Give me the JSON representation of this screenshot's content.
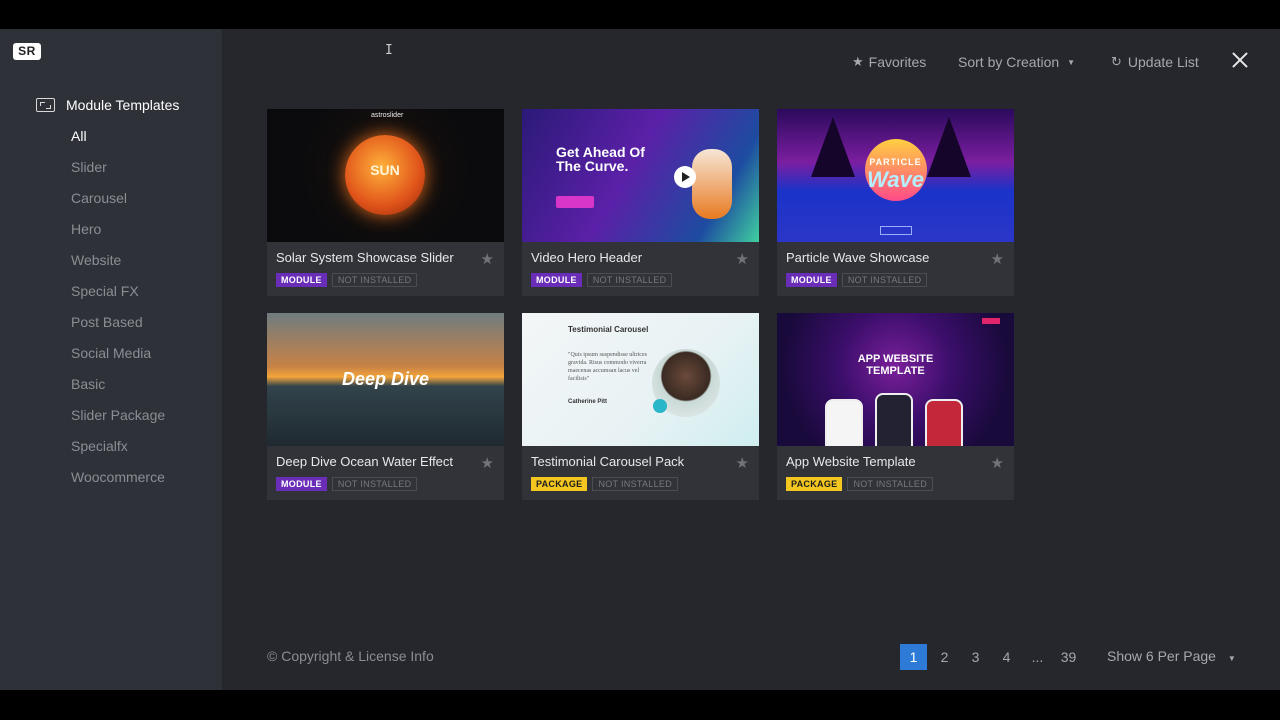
{
  "app": {
    "logo": "SR"
  },
  "sidebar": {
    "header": "Module Templates",
    "items": [
      {
        "label": "All",
        "active": true
      },
      {
        "label": "Slider"
      },
      {
        "label": "Carousel"
      },
      {
        "label": "Hero"
      },
      {
        "label": "Website"
      },
      {
        "label": "Special FX"
      },
      {
        "label": "Post Based"
      },
      {
        "label": "Social Media"
      },
      {
        "label": "Basic"
      },
      {
        "label": "Slider Package"
      },
      {
        "label": "Specialfx"
      },
      {
        "label": "Woocommerce"
      }
    ]
  },
  "toolbar": {
    "favorites": "Favorites",
    "sort": "Sort by Creation",
    "update": "Update List"
  },
  "cards": [
    {
      "title": "Solar System Showcase Slider",
      "type": "MODULE",
      "status": "NOT INSTALLED",
      "thumb_text": "SUN",
      "thumb_brand": "astroslider"
    },
    {
      "title": "Video Hero Header",
      "type": "MODULE",
      "status": "NOT INSTALLED",
      "thumb_text": "Get Ahead Of The Curve."
    },
    {
      "title": "Particle Wave Showcase",
      "type": "MODULE",
      "status": "NOT INSTALLED",
      "thumb_text": "PARTICLE",
      "thumb_text2": "Wave"
    },
    {
      "title": "Deep Dive Ocean Water Effect",
      "type": "MODULE",
      "status": "NOT INSTALLED",
      "thumb_text": "Deep Dive"
    },
    {
      "title": "Testimonial Carousel Pack",
      "type": "PACKAGE",
      "status": "NOT INSTALLED",
      "thumb_text": "Testimonial Carousel",
      "thumb_quote": "\"Quis ipsum suspendisse ultrices gravida. Risus commodo viverra maecenas accumsan lacus vel facilisis\"",
      "thumb_name": "Catherine Pitt"
    },
    {
      "title": "App Website Template",
      "type": "PACKAGE",
      "status": "NOT INSTALLED",
      "thumb_text": "APP WEBSITE TEMPLATE"
    }
  ],
  "footer": {
    "copyright": "© Copyright & License Info",
    "pages": [
      "1",
      "2",
      "3",
      "4",
      "...",
      "39"
    ],
    "current_page": "1",
    "per_page": "Show 6 Per Page"
  },
  "colors": {
    "module": "#6a2db8",
    "package": "#f4c620",
    "accent": "#2d7bd6"
  }
}
